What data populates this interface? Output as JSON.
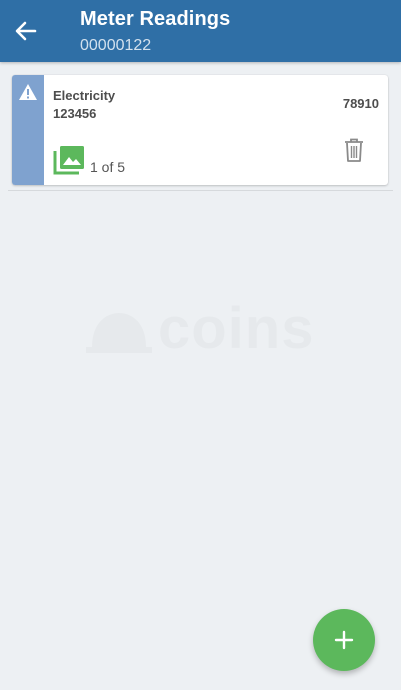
{
  "app_bar": {
    "title": "Meter Readings",
    "subtitle": "00000122",
    "back_icon": "arrow-left-icon",
    "color": "#2f6fa6"
  },
  "readings": [
    {
      "status_icon": "warning-icon",
      "type": "Electricity",
      "serial": "123456",
      "reading": "78910",
      "photo_icon": "photo-library-icon",
      "photo_count": "1 of 5",
      "delete_icon": "trash-icon",
      "strip_color": "#7fa2cf"
    }
  ],
  "watermark": {
    "logo_icon": "hard-hat-icon",
    "text": "coins"
  },
  "fab": {
    "icon": "plus-icon",
    "color": "#5cb85c"
  }
}
